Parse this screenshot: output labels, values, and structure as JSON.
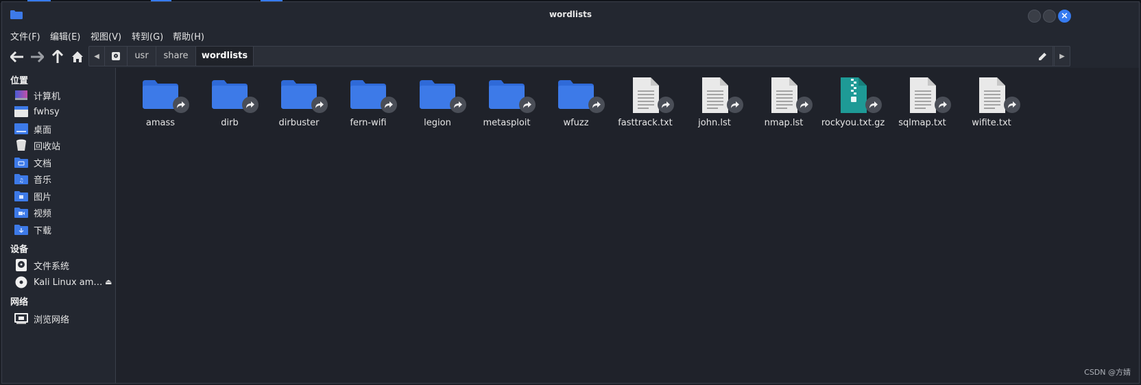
{
  "window": {
    "title": "wordlists"
  },
  "menu": [
    "文件(F)",
    "编辑(E)",
    "视图(V)",
    "转到(G)",
    "帮助(H)"
  ],
  "path": {
    "crumbs": [
      "usr",
      "share",
      "wordlists"
    ]
  },
  "sidebar": {
    "places_heading": "位置",
    "places": [
      {
        "label": "计算机",
        "icon": "computer-icon"
      },
      {
        "label": "fwhsy",
        "icon": "home-folder-icon"
      },
      {
        "label": "桌面",
        "icon": "desktop-icon"
      },
      {
        "label": "回收站",
        "icon": "trash-icon"
      },
      {
        "label": "文档",
        "icon": "documents-folder-icon"
      },
      {
        "label": "音乐",
        "icon": "music-folder-icon"
      },
      {
        "label": "图片",
        "icon": "pictures-folder-icon"
      },
      {
        "label": "视频",
        "icon": "videos-folder-icon"
      },
      {
        "label": "下载",
        "icon": "downloads-folder-icon"
      }
    ],
    "devices_heading": "设备",
    "devices": [
      {
        "label": "文件系统",
        "icon": "harddisk-icon"
      },
      {
        "label": "Kali Linux am…",
        "icon": "optical-disc-icon"
      }
    ],
    "network_heading": "网络",
    "network": [
      {
        "label": "浏览网络",
        "icon": "network-icon"
      }
    ]
  },
  "files": [
    {
      "name": "amass",
      "type": "folder"
    },
    {
      "name": "dirb",
      "type": "folder"
    },
    {
      "name": "dirbuster",
      "type": "folder"
    },
    {
      "name": "fern-wifi",
      "type": "folder"
    },
    {
      "name": "legion",
      "type": "folder"
    },
    {
      "name": "metasploit",
      "type": "folder"
    },
    {
      "name": "wfuzz",
      "type": "folder"
    },
    {
      "name": "fasttrack.txt",
      "type": "text"
    },
    {
      "name": "john.lst",
      "type": "text"
    },
    {
      "name": "nmap.lst",
      "type": "text"
    },
    {
      "name": "rockyou.txt.gz",
      "type": "archive"
    },
    {
      "name": "sqlmap.txt",
      "type": "text"
    },
    {
      "name": "wifite.txt",
      "type": "text"
    }
  ],
  "watermark": "CSDN @方婧",
  "colors": {
    "accent": "#367bf0",
    "folder": "#3d7ae8",
    "archive": "#1e9a96",
    "background": "#1f222a"
  }
}
